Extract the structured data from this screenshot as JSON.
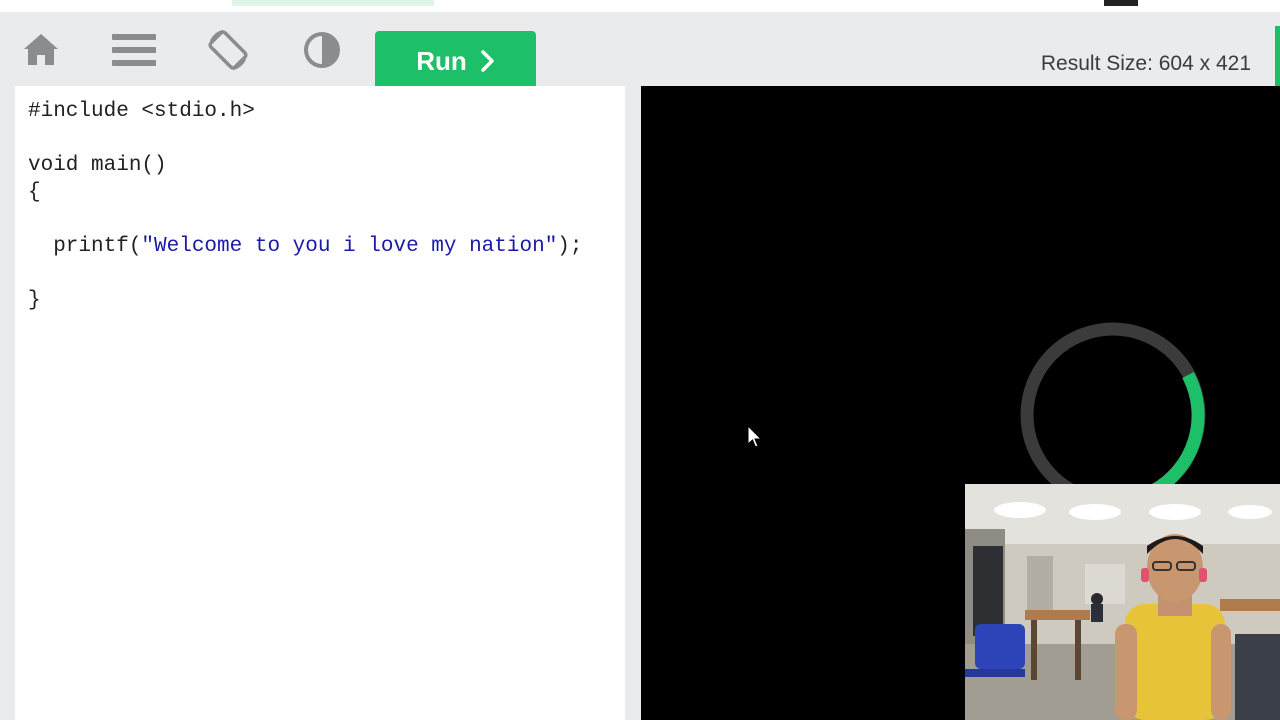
{
  "toolbar": {
    "icons": [
      "home-icon",
      "menu-icon",
      "rotate-icon",
      "contrast-icon"
    ],
    "run_label": "Run",
    "run_icon": "chevron-right-icon",
    "result_size": "Result Size: 604 x 421",
    "accent_color": "#1dbf69"
  },
  "editor": {
    "lines": [
      "#include <stdio.h>",
      "",
      "void main()",
      "{",
      "",
      "  printf(\"Welcome to you i love my nation\");",
      "",
      "}"
    ]
  },
  "result": {
    "background": "#000000",
    "spinner_icon": "loading-spinner-icon",
    "spinner_color": "#1dbf69"
  },
  "webcam": {
    "description_icon": "webcam-overlay"
  }
}
